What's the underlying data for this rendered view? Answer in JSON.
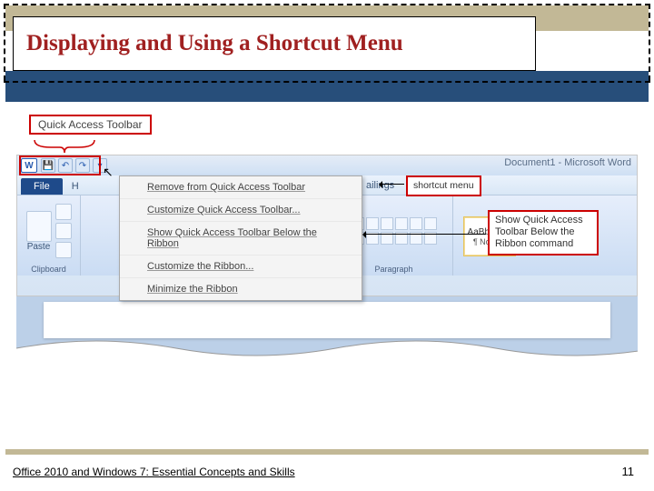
{
  "slide": {
    "title": "Displaying and Using a Shortcut Menu"
  },
  "callouts": {
    "qat_label": "Quick Access Toolbar",
    "shortcut_menu_label": "shortcut menu",
    "show_below_label": "Show Quick Access Toolbar Below the Ribbon command"
  },
  "titlebar": {
    "doc_title": "Document1 - Microsoft Word",
    "word_icon": "W"
  },
  "tabs": {
    "file": "File",
    "home_frag": "H",
    "mailings_frag": "ailings"
  },
  "ribbon": {
    "clipboard": {
      "label": "Clipboard",
      "paste": "Paste"
    },
    "paragraph": {
      "label": "Paragraph"
    },
    "styles": {
      "preview": "AaBbCcDc",
      "name": "¶ Normal"
    }
  },
  "context_menu": {
    "items": [
      "Remove from Quick Access Toolbar",
      "Customize Quick Access Toolbar...",
      "Show Quick Access Toolbar Below the Ribbon",
      "Customize the Ribbon...",
      "Minimize the Ribbon"
    ]
  },
  "footer": {
    "text": "Office 2010 and Windows 7: Essential Concepts and Skills",
    "page": "11"
  }
}
